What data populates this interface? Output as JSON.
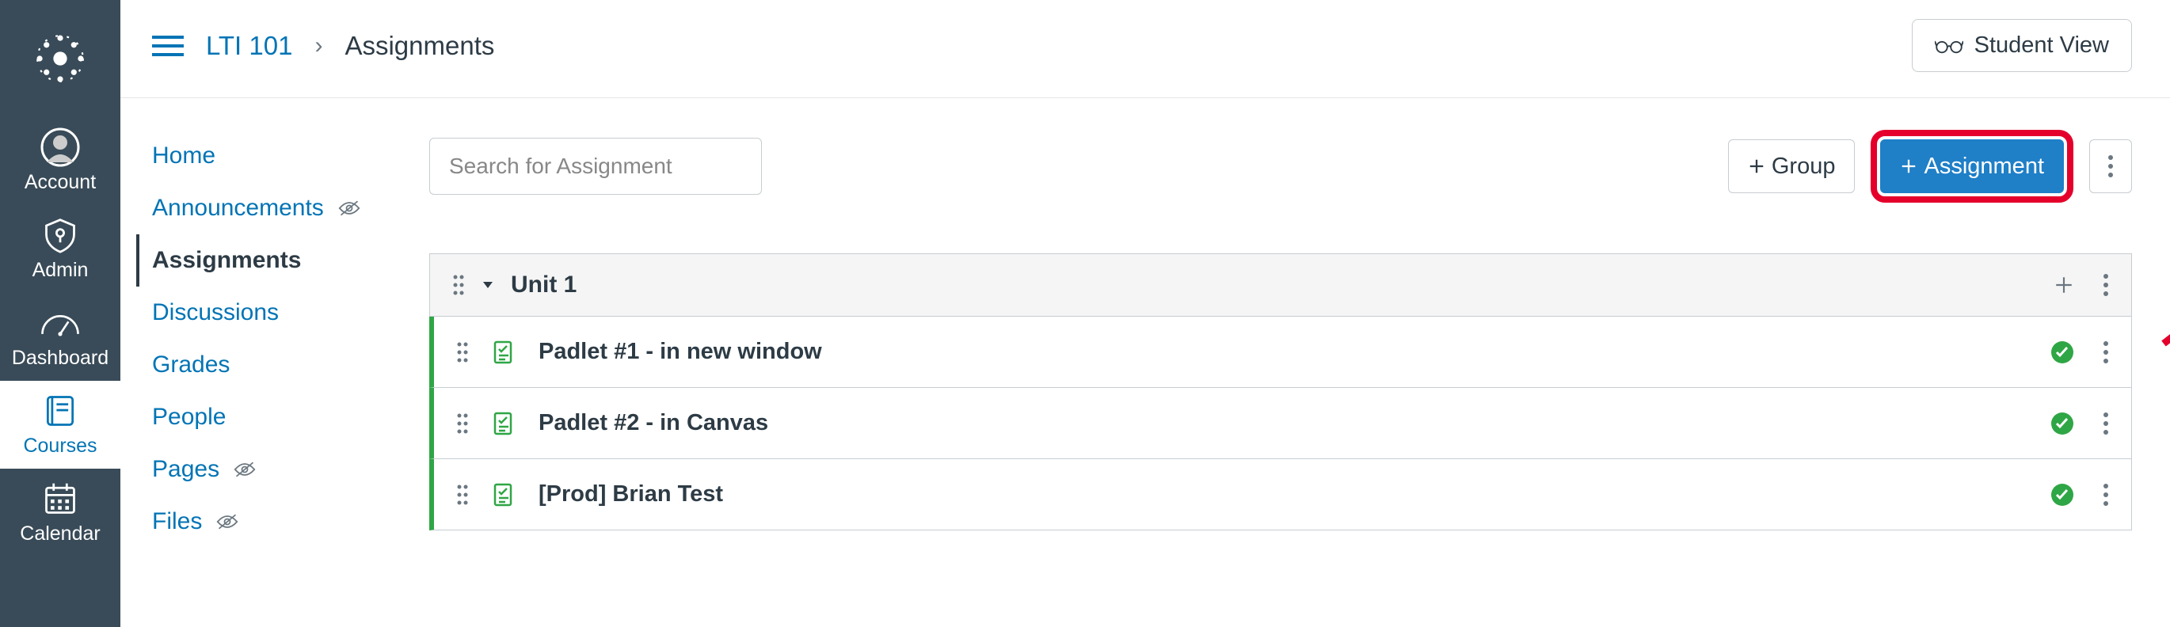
{
  "global_nav": {
    "items": [
      {
        "label": "Account"
      },
      {
        "label": "Admin"
      },
      {
        "label": "Dashboard"
      },
      {
        "label": "Courses"
      },
      {
        "label": "Calendar"
      }
    ]
  },
  "breadcrumb": {
    "course": "LTI 101",
    "current": "Assignments"
  },
  "student_view_label": "Student View",
  "course_nav": {
    "items": [
      {
        "label": "Home",
        "active": false,
        "hidden": false
      },
      {
        "label": "Announcements",
        "active": false,
        "hidden": true
      },
      {
        "label": "Assignments",
        "active": true,
        "hidden": false
      },
      {
        "label": "Discussions",
        "active": false,
        "hidden": false
      },
      {
        "label": "Grades",
        "active": false,
        "hidden": false
      },
      {
        "label": "People",
        "active": false,
        "hidden": false
      },
      {
        "label": "Pages",
        "active": false,
        "hidden": true
      },
      {
        "label": "Files",
        "active": false,
        "hidden": true
      }
    ]
  },
  "search": {
    "placeholder": "Search for Assignment"
  },
  "buttons": {
    "group": "Group",
    "assignment": "Assignment"
  },
  "group": {
    "title": "Unit 1"
  },
  "assignments": [
    {
      "title": "Padlet #1 - in new window"
    },
    {
      "title": "Padlet #2 - in Canvas"
    },
    {
      "title": "[Prod] Brian Test"
    }
  ]
}
